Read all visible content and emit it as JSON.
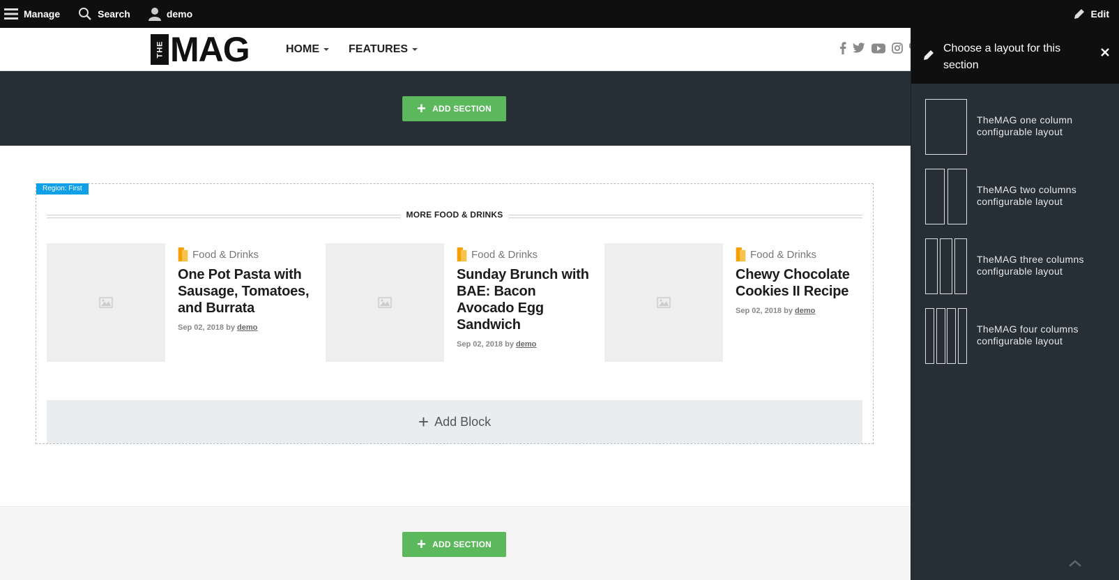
{
  "toolbar": {
    "manage_label": "Manage",
    "search_label": "Search",
    "user_label": "demo",
    "edit_label": "Edit"
  },
  "site": {
    "logo_small": "THE",
    "logo_big": "MAG",
    "nav": [
      {
        "label": "HOME"
      },
      {
        "label": "FEATURES"
      }
    ],
    "socials": [
      "facebook-icon",
      "twitter-icon",
      "youtube-icon",
      "instagram-icon",
      "pinterest-icon"
    ]
  },
  "builder": {
    "add_section_label": "ADD SECTION",
    "region_label": "Region: First",
    "section_title": "MORE FOOD & DRINKS",
    "add_block_label": "Add Block"
  },
  "articles": [
    {
      "category": "Food & Drinks",
      "title": "One Pot Pasta with Sausage, Tomatoes, and Burrata",
      "date": "Sep 02, 2018",
      "by": "by",
      "author": "demo"
    },
    {
      "category": "Food & Drinks",
      "title": "Sunday Brunch with BAE: Bacon Avocado Egg Sandwich",
      "date": "Sep 02, 2018",
      "by": "by",
      "author": "demo"
    },
    {
      "category": "Food & Drinks",
      "title": "Chewy Chocolate Cookies II Recipe",
      "date": "Sep 02, 2018",
      "by": "by",
      "author": "demo"
    }
  ],
  "panel": {
    "title": "Choose a layout for this section",
    "layouts": [
      {
        "label": "TheMAG one column configurable layout",
        "columns": 1
      },
      {
        "label": "TheMAG two columns configurable layout",
        "columns": 2
      },
      {
        "label": "TheMAG three columns configurable layout",
        "columns": 3
      },
      {
        "label": "TheMAG four columns configurable layout",
        "columns": 4
      }
    ]
  },
  "colors": {
    "toolbar_bg": "#0f0f0f",
    "dark_band": "#252f35",
    "add_section_green": "#5cb85c",
    "region_label_blue": "#0fa0e8",
    "category_orange": "#f5a000"
  }
}
